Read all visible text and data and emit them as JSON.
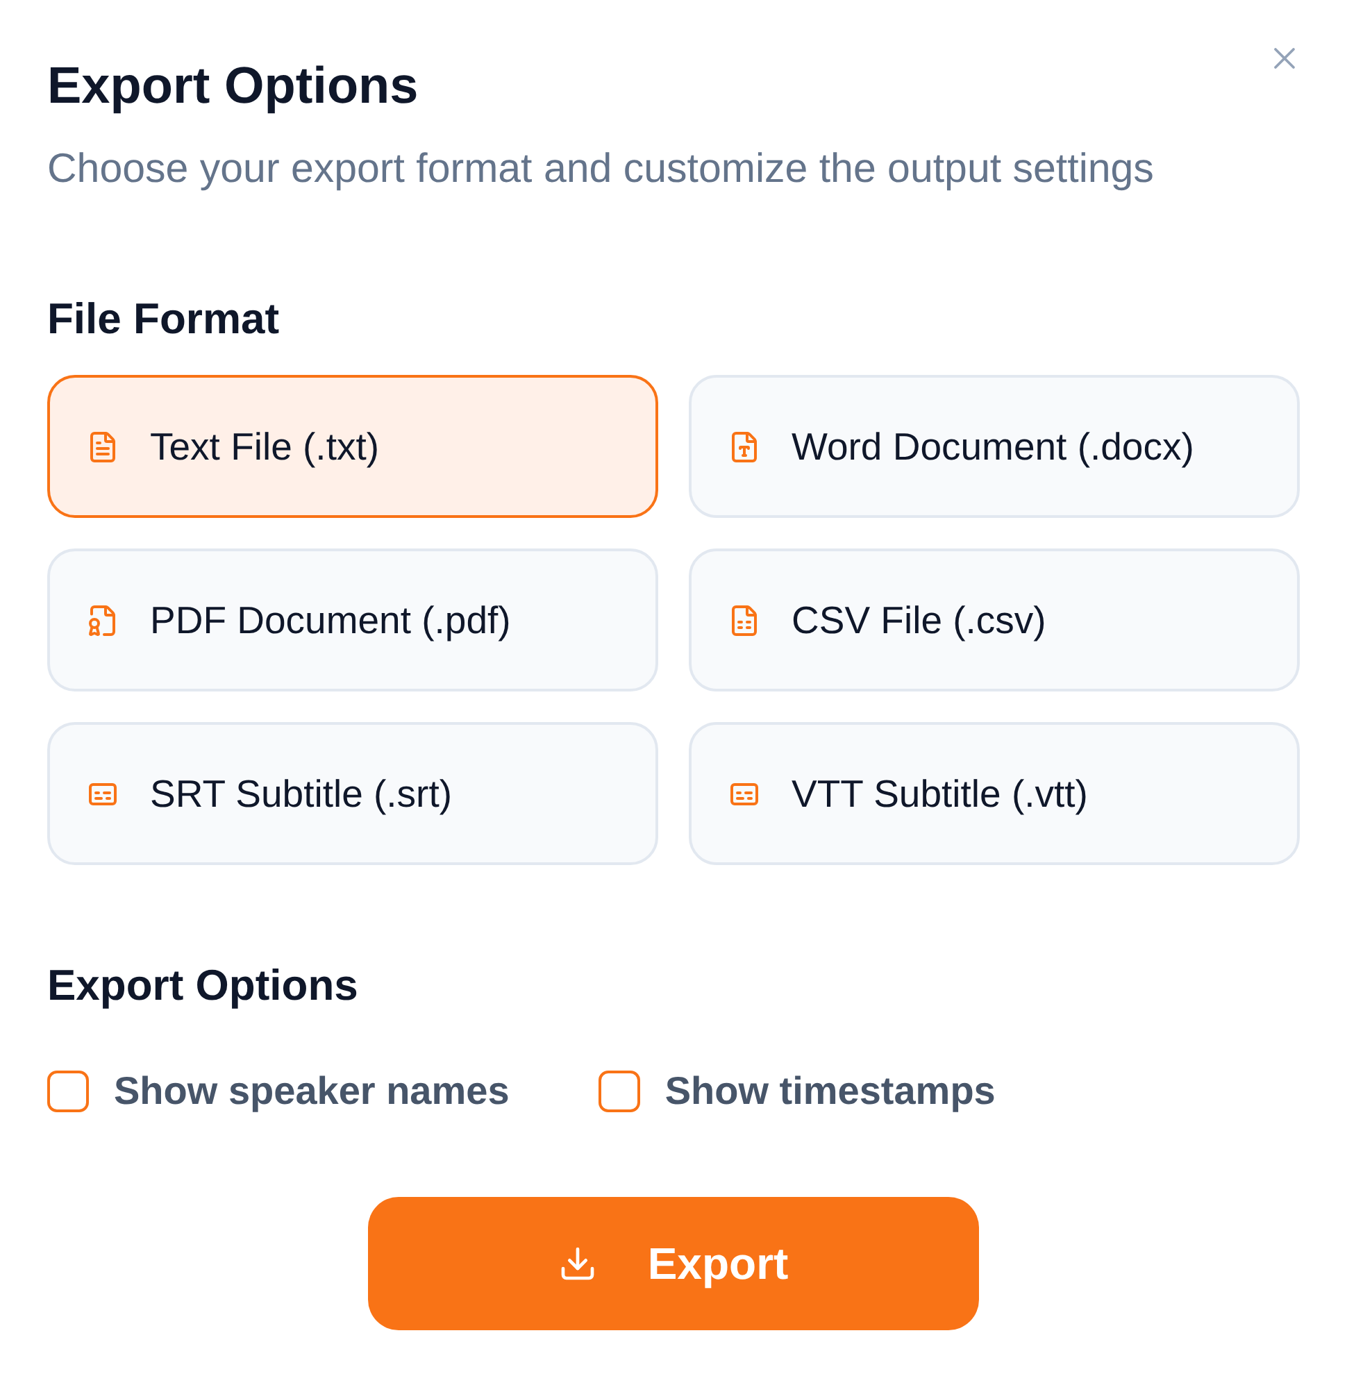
{
  "dialog": {
    "title": "Export Options",
    "subtitle": "Choose your export format and customize the output settings"
  },
  "file_format": {
    "heading": "File Format",
    "options": [
      {
        "label": "Text File (.txt)",
        "kind": "text",
        "selected": true
      },
      {
        "label": "Word Document (.docx)",
        "kind": "word",
        "selected": false
      },
      {
        "label": "PDF Document (.pdf)",
        "kind": "pdf",
        "selected": false
      },
      {
        "label": "CSV File (.csv)",
        "kind": "csv",
        "selected": false
      },
      {
        "label": "SRT Subtitle (.srt)",
        "kind": "subtitle",
        "selected": false
      },
      {
        "label": "VTT Subtitle (.vtt)",
        "kind": "subtitle",
        "selected": false
      }
    ]
  },
  "export_options": {
    "heading": "Export Options",
    "checkboxes": [
      {
        "label": "Show speaker names",
        "checked": false
      },
      {
        "label": "Show timestamps",
        "checked": false
      }
    ]
  },
  "export_button": {
    "label": "Export"
  }
}
